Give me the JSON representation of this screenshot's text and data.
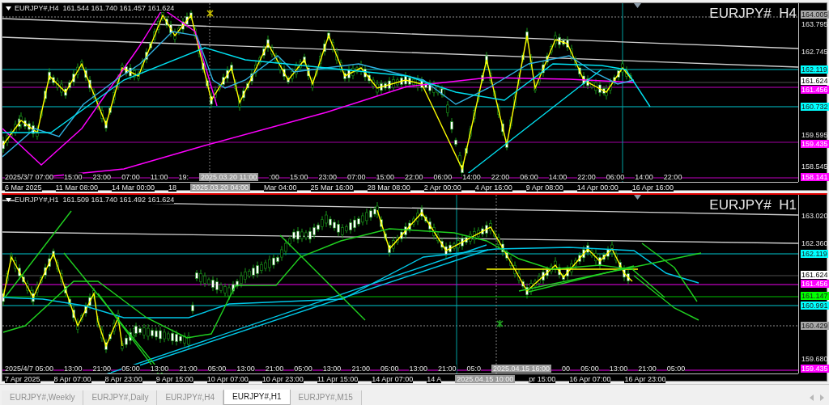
{
  "charts": [
    {
      "selected": false,
      "header": "EURJPY#,H4  161.544 161.740 161.457 161.624",
      "symbol_label": "EURJPY#  H4",
      "price_labels": [
        {
          "text": "164.005",
          "kind": "marker",
          "color": "#a8a8a8"
        },
        {
          "text": "163.795",
          "kind": "tick"
        },
        {
          "text": "162.745",
          "kind": "tick"
        },
        {
          "text": "162.119",
          "kind": "marker",
          "color": "#00ffff"
        },
        {
          "text": "161.624",
          "kind": "marker",
          "color": "#ffffff"
        },
        {
          "text": "161.456",
          "kind": "marker",
          "color": "#ff00ff"
        },
        {
          "text": "160.732",
          "kind": "marker",
          "color": "#00ffff"
        },
        {
          "text": "159.595",
          "kind": "tick"
        },
        {
          "text": "159.435",
          "kind": "marker",
          "color": "#ff00ff"
        },
        {
          "text": "158.545",
          "kind": "tick"
        },
        {
          "text": "158.141",
          "kind": "marker",
          "color": "#ff00ff"
        }
      ],
      "inner_time_labels": [
        {
          "text": "2025/3/7 07:00",
          "kind": "tick"
        },
        {
          "text": "15:00",
          "kind": "tick"
        },
        {
          "text": "23:00",
          "kind": "tick"
        },
        {
          "text": "07:00",
          "kind": "tick"
        },
        {
          "text": "11:00",
          "kind": "tick"
        },
        {
          "text": "19:",
          "kind": "tick"
        },
        {
          "text": "2025.03.20 11:00",
          "kind": "cursor"
        },
        {
          "text": ":00",
          "kind": "tick"
        },
        {
          "text": "15:00",
          "kind": "tick"
        },
        {
          "text": "23:00",
          "kind": "tick"
        },
        {
          "text": "07:00",
          "kind": "tick"
        },
        {
          "text": "15:00",
          "kind": "tick"
        },
        {
          "text": "22:00",
          "kind": "tick"
        },
        {
          "text": "06:00",
          "kind": "tick"
        },
        {
          "text": "14:00",
          "kind": "tick"
        },
        {
          "text": "22:00",
          "kind": "tick"
        },
        {
          "text": "06:00",
          "kind": "tick"
        },
        {
          "text": "14:00",
          "kind": "tick"
        },
        {
          "text": "22:00",
          "kind": "tick"
        },
        {
          "text": "06:00",
          "kind": "tick"
        },
        {
          "text": "14:00",
          "kind": "tick"
        },
        {
          "text": "22:00",
          "kind": "tick"
        }
      ],
      "time_axis_labels": [
        {
          "text": "6 Mar 2025",
          "kind": "tick"
        },
        {
          "text": "11 Mar 08:00",
          "kind": "tick"
        },
        {
          "text": "14 Mar 00:00",
          "kind": "tick"
        },
        {
          "text": "18",
          "kind": "tick"
        },
        {
          "text": "2025.03.20 04:00",
          "kind": "cursor"
        },
        {
          "text": "Mar 04:00",
          "kind": "tick"
        },
        {
          "text": "25 Mar 16:00",
          "kind": "tick"
        },
        {
          "text": "28 Mar 08:00",
          "kind": "tick"
        },
        {
          "text": "2 Apr 00:00",
          "kind": "tick"
        },
        {
          "text": "4 Apr 16:00",
          "kind": "tick"
        },
        {
          "text": "9 Apr 08:00",
          "kind": "tick"
        },
        {
          "text": "14 Apr 00:00",
          "kind": "tick"
        },
        {
          "text": "16 Apr 16:00",
          "kind": "tick"
        }
      ]
    },
    {
      "selected": true,
      "header": "EURJPY#,H1  161.509 161.740 161.492 161.624",
      "symbol_label": "EURJPY#  H1",
      "price_labels": [
        {
          "text": "163.020",
          "kind": "tick"
        },
        {
          "text": "162.360",
          "kind": "tick"
        },
        {
          "text": "162.119",
          "kind": "marker",
          "color": "#00ffff"
        },
        {
          "text": "161.624",
          "kind": "marker",
          "color": "#ffffff"
        },
        {
          "text": "161.456",
          "kind": "marker",
          "color": "#ff00ff"
        },
        {
          "text": "161.147",
          "kind": "marker",
          "color": "#00ff00"
        },
        {
          "text": "160.991",
          "kind": "marker",
          "color": "#00ffff"
        },
        {
          "text": "160.429",
          "kind": "marker",
          "color": "#a8a8a8"
        },
        {
          "text": "159.680",
          "kind": "tick"
        },
        {
          "text": "159.435",
          "kind": "marker",
          "color": "#ff00ff"
        }
      ],
      "inner_time_labels": [
        {
          "text": "2025/4/7 05:00",
          "kind": "tick"
        },
        {
          "text": "13:00",
          "kind": "tick"
        },
        {
          "text": "21:00",
          "kind": "tick"
        },
        {
          "text": "05:00",
          "kind": "tick"
        },
        {
          "text": "13:00",
          "kind": "tick"
        },
        {
          "text": "21:00",
          "kind": "tick"
        },
        {
          "text": "05:00",
          "kind": "tick"
        },
        {
          "text": "13:00",
          "kind": "tick"
        },
        {
          "text": "21:00",
          "kind": "tick"
        },
        {
          "text": "05:00",
          "kind": "tick"
        },
        {
          "text": "13:00",
          "kind": "tick"
        },
        {
          "text": "21:00",
          "kind": "tick"
        },
        {
          "text": "05:00",
          "kind": "tick"
        },
        {
          "text": "13:00",
          "kind": "tick"
        },
        {
          "text": "21:00",
          "kind": "tick"
        },
        {
          "text": "05:0",
          "kind": "tick"
        },
        {
          "text": "2025.04.15 16:00",
          "kind": "cursor"
        },
        {
          "text": "00",
          "kind": "tick"
        },
        {
          "text": "05:00",
          "kind": "tick"
        },
        {
          "text": "13:00",
          "kind": "tick"
        },
        {
          "text": "21:00",
          "kind": "tick"
        },
        {
          "text": "05:00",
          "kind": "tick"
        }
      ],
      "time_axis_labels": [
        {
          "text": "7 Apr 2025",
          "kind": "tick"
        },
        {
          "text": "8 Apr 07:00",
          "kind": "tick"
        },
        {
          "text": "8 Apr 23:00",
          "kind": "tick"
        },
        {
          "text": "9 Apr 15:00",
          "kind": "tick"
        },
        {
          "text": "10 Apr 07:00",
          "kind": "tick"
        },
        {
          "text": "10 Apr 23:00",
          "kind": "tick"
        },
        {
          "text": "11 Apr 15:00",
          "kind": "tick"
        },
        {
          "text": "14 Apr 07:00",
          "kind": "tick"
        },
        {
          "text": "14 A",
          "kind": "tick"
        },
        {
          "text": "2025.04.15 10:00",
          "kind": "cursor"
        },
        {
          "text": "pr 15:00",
          "kind": "tick"
        },
        {
          "text": "16 Apr 07:00",
          "kind": "tick"
        },
        {
          "text": "16 Apr 23:00",
          "kind": "tick"
        }
      ]
    }
  ],
  "tabs": [
    {
      "label": "EURJPY#,Weekly",
      "selected": false
    },
    {
      "label": "EURJPY#,Daily",
      "selected": false
    },
    {
      "label": "EURJPY#,H4",
      "selected": false
    },
    {
      "label": "EURJPY#,H1",
      "selected": true
    },
    {
      "label": "EURJPY#,M15",
      "selected": false
    }
  ]
}
